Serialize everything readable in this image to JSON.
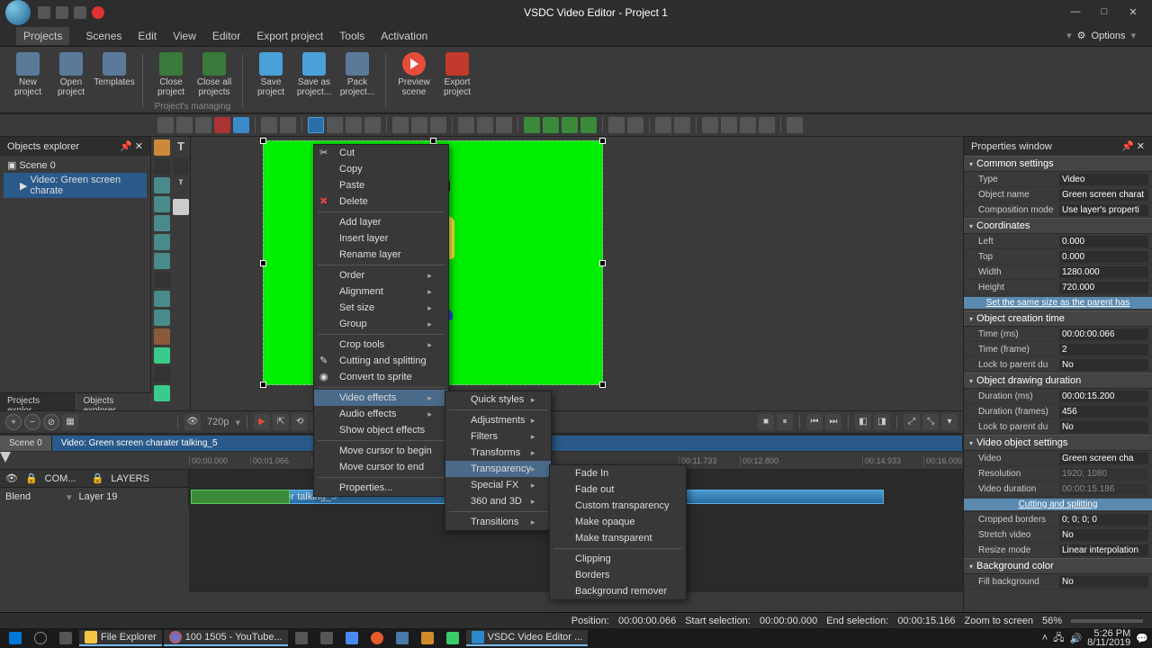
{
  "title": "VSDC Video Editor - Project 1",
  "menubar": [
    "Projects",
    "Scenes",
    "Edit",
    "View",
    "Editor",
    "Export project",
    "Tools",
    "Activation"
  ],
  "menubar_right": "Options",
  "ribbon": {
    "group1": [
      {
        "label": "New\nproject"
      },
      {
        "label": "Open\nproject"
      },
      {
        "label": "Templates"
      }
    ],
    "group2_label": "Project's managing",
    "group2": [
      {
        "label": "Close\nproject"
      },
      {
        "label": "Close all\nprojects"
      }
    ],
    "group3": [
      {
        "label": "Save\nproject"
      },
      {
        "label": "Save as\nproject..."
      },
      {
        "label": "Pack\nproject..."
      }
    ],
    "group4": [
      {
        "label": "Preview\nscene"
      },
      {
        "label": "Export\nproject"
      }
    ]
  },
  "objects_panel": {
    "title": "Objects explorer",
    "scene": "Scene 0",
    "item": "Video: Green screen charate"
  },
  "tabs_bottom": [
    "Projects explor...",
    "Objects explorer"
  ],
  "timeline": {
    "resolution": "720p",
    "scene_tab": "Scene 0",
    "selected_tab": "Video: Green screen charater talking_5",
    "ticks": [
      "00:00.000",
      "00:01.066",
      "00:02.133",
      "",
      "",
      "",
      "",
      "",
      "",
      "",
      "",
      "00:11.733",
      "00:12.800",
      "",
      "00:14.933",
      "00:16.000"
    ],
    "track_cols": [
      "COM...",
      "LAYERS"
    ],
    "track_blend": "Blend",
    "track_layer": "Layer 19",
    "clip_label": "Green screen charater talking_5"
  },
  "context_menu1": [
    {
      "label": "Cut",
      "icon": "✂"
    },
    {
      "label": "Copy"
    },
    {
      "label": "Paste",
      "disabled": true
    },
    {
      "label": "Delete",
      "icon": "✖",
      "iconcls": "x"
    },
    {
      "sep": true
    },
    {
      "label": "Add layer"
    },
    {
      "label": "Insert layer"
    },
    {
      "label": "Rename layer"
    },
    {
      "sep": true
    },
    {
      "label": "Order",
      "arrow": true
    },
    {
      "label": "Alignment",
      "arrow": true
    },
    {
      "label": "Set size",
      "arrow": true
    },
    {
      "label": "Group",
      "arrow": true
    },
    {
      "sep": true
    },
    {
      "label": "Crop tools",
      "arrow": true
    },
    {
      "label": "Cutting and splitting",
      "icon": "✎"
    },
    {
      "label": "Convert to sprite",
      "icon": "◉"
    },
    {
      "sep": true
    },
    {
      "label": "Video effects",
      "arrow": true,
      "hover": true
    },
    {
      "label": "Audio effects",
      "arrow": true
    },
    {
      "label": "Show object effects"
    },
    {
      "sep": true
    },
    {
      "label": "Move cursor to begin"
    },
    {
      "label": "Move cursor to end"
    },
    {
      "sep": true
    },
    {
      "label": "Properties...",
      "disabled": true
    }
  ],
  "context_menu2": [
    {
      "label": "Quick styles",
      "arrow": true
    },
    {
      "sep": true
    },
    {
      "label": "Adjustments",
      "arrow": true
    },
    {
      "label": "Filters",
      "arrow": true
    },
    {
      "label": "Transforms",
      "arrow": true
    },
    {
      "label": "Transparency",
      "arrow": true,
      "hover": true
    },
    {
      "label": "Special FX",
      "arrow": true
    },
    {
      "label": "360 and 3D",
      "arrow": true
    },
    {
      "sep": true
    },
    {
      "label": "Transitions",
      "arrow": true
    }
  ],
  "context_menu3": [
    {
      "label": "Fade In"
    },
    {
      "label": "Fade out"
    },
    {
      "label": "Custom transparency"
    },
    {
      "label": "Make opaque"
    },
    {
      "label": "Make transparent"
    },
    {
      "sep": true
    },
    {
      "label": "Clipping"
    },
    {
      "label": "Borders"
    },
    {
      "label": "Background remover"
    }
  ],
  "props": {
    "title": "Properties window",
    "sections": {
      "common": "Common settings",
      "coords": "Coordinates",
      "creation": "Object creation time",
      "drawing": "Object drawing duration",
      "video": "Video object settings",
      "cropped_label": "Cropped borders",
      "bg": "Background color"
    },
    "rows": {
      "type_k": "Type",
      "type_v": "Video",
      "name_k": "Object name",
      "name_v": "Green screen charat",
      "comp_k": "Composition mode",
      "comp_v": "Use layer's properti",
      "left_k": "Left",
      "left_v": "0.000",
      "top_k": "Top",
      "top_v": "0.000",
      "width_k": "Width",
      "width_v": "1280.000",
      "height_k": "Height",
      "height_v": "720.000",
      "samesize": "Set the same size as the parent has",
      "timems_k": "Time (ms)",
      "timems_v": "00:00:00.066",
      "timefr_k": "Time (frame)",
      "timefr_v": "2",
      "lock1_k": "Lock to parent du",
      "lock1_v": "No",
      "durms_k": "Duration (ms)",
      "durms_v": "00:00:15.200",
      "durfr_k": "Duration (frames)",
      "durfr_v": "456",
      "lock2_k": "Lock to parent du",
      "lock2_v": "No",
      "vid_k": "Video",
      "vid_v": "Green screen cha",
      "res_k": "Resolution",
      "res_v": "1920; 1080",
      "vdur_k": "Video duration",
      "vdur_v": "00:00:15.186",
      "cutlink": "Cutting and splitting",
      "crop_v": "0; 0; 0; 0",
      "stretch_k": "Stretch video",
      "stretch_v": "No",
      "resize_k": "Resize mode",
      "resize_v": "Linear interpolation",
      "fill_k": "Fill background",
      "fill_v": "No"
    }
  },
  "status": {
    "pos_l": "Position:",
    "pos_v": "00:00:00.066",
    "start_l": "Start selection:",
    "start_v": "00:00:00.000",
    "end_l": "End selection:",
    "end_v": "00:00:15.166",
    "zoom_l": "Zoom to screen",
    "zoom_v": "56%"
  },
  "taskbar": {
    "items": [
      "File Explorer",
      "100 1505 - YouTube...",
      "VSDC Video Editor ..."
    ],
    "time": "5:26 PM",
    "date": "8/11/2019"
  }
}
